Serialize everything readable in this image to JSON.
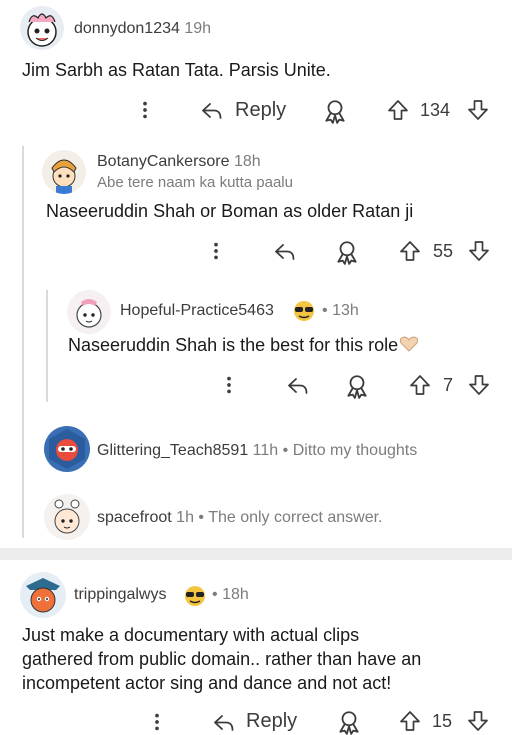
{
  "comments": [
    {
      "username": "donnydon1234",
      "time": "19h",
      "body": "Jim Sarbh as Ratan Tata. Parsis Unite.",
      "actions": {
        "reply_label": "Reply",
        "votes": "134"
      }
    },
    {
      "username": "BotanyCankersore",
      "time": "18h",
      "flair": "Abe tere naam ka kutta paalu",
      "body": "Naseeruddin Shah or Boman as older Ratan ji",
      "actions": {
        "votes": "55"
      }
    },
    {
      "username": "Hopeful-Practice5463",
      "time": "13h",
      "separator": "•",
      "body": "Naseeruddin Shah is the best for this role",
      "actions": {
        "votes": "7"
      }
    },
    {
      "username": "Glittering_Teach8591",
      "time": "11h",
      "separator": "•",
      "body": "Ditto my thoughts"
    },
    {
      "username": "spacefroot",
      "time": "1h",
      "separator": "•",
      "body": "The only correct answer."
    },
    {
      "username": "trippingalwys",
      "time": "18h",
      "separator": "•",
      "body_lines": [
        "Just make a documentary with actual clips",
        "gathered from public domain.. rather than have an",
        "incompetent actor sing and dance and not act!"
      ],
      "actions": {
        "reply_label": "Reply",
        "votes": "15"
      }
    }
  ],
  "icons": {
    "more": "more-vertical-icon",
    "reply": "reply-arrow-icon",
    "award": "award-icon",
    "upvote": "upvote-arrow-icon",
    "downvote": "downvote-arrow-icon",
    "flair_emoji": "sunglasses-emoji-icon",
    "heart_emoji": "heart-hands-emoji-icon"
  },
  "colors": {
    "text": "#1a1a1b",
    "muted": "#7c7c7c",
    "icon": "#3c3c3c",
    "thread_line": "#dadada",
    "separator": "#ededed"
  }
}
